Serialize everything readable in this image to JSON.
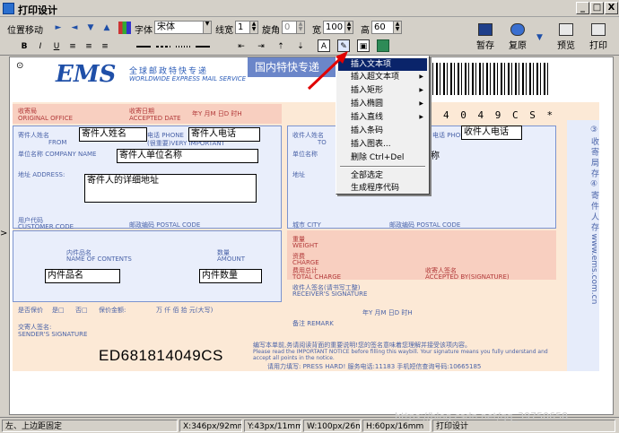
{
  "window": {
    "title": "打印设计",
    "controls": [
      "_",
      "□",
      "X"
    ]
  },
  "toolbar1": {
    "position_move": "位置移动",
    "move_buttons": [
      "►",
      "◄",
      "▼",
      "▲"
    ],
    "font_label": "字体",
    "font_value": "宋体",
    "line_width_label": "线宽",
    "line_width_value": "1",
    "rotate_label": "旋角",
    "rotate_value": "0",
    "width_label": "宽",
    "width_value": "100",
    "height_label": "高",
    "height_value": "60"
  },
  "toolbar2": {
    "format_buttons": [
      "B",
      "I",
      "U"
    ]
  },
  "big_buttons": {
    "pause": "暂存",
    "restore": "复原",
    "preview": "预览",
    "print": "打印"
  },
  "form": {
    "logo": "EMS",
    "banner": "国内特快专递",
    "cn_title": "全球邮政特快专递",
    "en_title": "WORLDWIDE EXPRESS MAIL SERVICE",
    "barcode_number": "4 0 4 9 C S *",
    "origin_office": "收寄局",
    "origin_office_en": "ORIGINAL OFFICE",
    "accept_date": "收寄日期",
    "accept_date_en": "ACCEPTED DATE",
    "date_units": "年Y  月M  日D  时H",
    "sender_name_label": "寄件人姓名",
    "sender_name_en": "FROM",
    "sender_phone_label": "电话 PHONE",
    "very_important": "(很重要)VERY IMPORTANT",
    "company_label": "单位名称 COMPANY NAME",
    "address_label": "地址 ADDRESS:",
    "customer_code": "用户代码",
    "customer_code_en": "CUSTOMER CODE",
    "postal_code": "邮政编码 POSTAL CODE",
    "to_label": "收件人姓名",
    "to_en": "TO",
    "to_phone_label": "电话 PHONE",
    "to_company": "单位名称",
    "to_address": "地址",
    "city_label": "城市 CITY",
    "contents_label": "内件品名",
    "contents_en": "NAME OF CONTENTS",
    "amount_label": "数量",
    "amount_en": "AMOUNT",
    "weight_label": "重量",
    "weight_en": "WEIGHT",
    "charge_label": "资费",
    "charge_en": "CHARGE",
    "total_label": "费用总计",
    "total_en": "TOTAL CHARGE",
    "accepted_by": "收寄人签名",
    "accepted_by_en": "ACCEPTED BY(SIGNATURE)",
    "insured_label": "是否保价",
    "insured_yes": "是□",
    "insured_no": "否□",
    "insured_amount": "保价金额:",
    "money_units": "万 仟 佰 拾 元(大写)",
    "sender_sig": "交寄人签名:",
    "sender_sig_en": "SENDER'S SIGNATURE",
    "receiver_sig": "收件人签名(请书写工整)",
    "receiver_sig_en": "RECEIVER'S SIGNATURE",
    "receiver_date": "年Y  月M  日D  时H",
    "remark_label": "备注 REMARK",
    "notice_cn": "编写本单前,务请阅读背面的重要说明!您的签名意味着您理解并接受该项内容。",
    "notice_en": "Please read the IMPORTANT NOTICE before filling this waybill. Your signature means you fully understand and accept all points in the notice.",
    "press_hard": "请用力填写:  PRESS HARD!  服务电话:11183  手机短信查询号码:10665185",
    "tracking_number": "ED681814049CS",
    "sidebar": "③ 收 寄 局 存   ④ 寄 件 人 存   www.ems.com.cn",
    "fields": {
      "sender_name": "寄件人姓名",
      "sender_phone": "寄件人电话",
      "sender_company": "寄件人单位名称",
      "sender_address": "寄件人的详细地址",
      "receiver_phone": "收件人电话",
      "contents": "内件品名",
      "quantity": "内件数量",
      "receiver_company_tail": "称"
    }
  },
  "context_menu": [
    {
      "label": "插入文本项",
      "sub": false,
      "hl": true
    },
    {
      "label": "插入超文本项",
      "sub": true
    },
    {
      "label": "插入矩形",
      "sub": true
    },
    {
      "label": "插入椭圆",
      "sub": true
    },
    {
      "label": "插入直线",
      "sub": true
    },
    {
      "label": "插入条码",
      "sub": false
    },
    {
      "label": "插入图表...",
      "sub": false
    },
    {
      "label": "删除    Ctrl+Del",
      "sub": false
    },
    {
      "label": "全部选定",
      "sub": false
    },
    {
      "label": "生成程序代码",
      "sub": false
    }
  ],
  "status": {
    "left": "左、上边距固定",
    "x": "X:346px/92mm",
    "y": "Y:43px/11mm",
    "w": "W:100px/26mm",
    "h": "H:60px/16mm",
    "mode": "打印设计"
  },
  "watermark": "https://blog.csdn.net/qq_39750658"
}
